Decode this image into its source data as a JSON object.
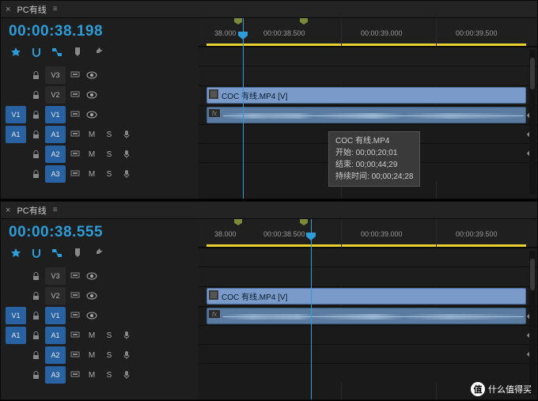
{
  "panels": [
    {
      "tab_close": "×",
      "tab_title": "PC有线",
      "menu_glyph": "≡",
      "timecode": "00:00:38.198",
      "ticks": [
        "38.000",
        "00:00:38.500",
        "00:00:39.000",
        "00:00:39.500"
      ],
      "tracks": {
        "v3": {
          "label": "V3"
        },
        "v2": {
          "label": "V2"
        },
        "v1": {
          "src": "V1",
          "tgt": "V1"
        },
        "a1": {
          "src": "A1",
          "tgt": "A1",
          "m": "M",
          "s": "S"
        },
        "a2": {
          "tgt": "A2",
          "m": "M",
          "s": "S"
        },
        "a3": {
          "tgt": "A3",
          "m": "M",
          "s": "S"
        }
      },
      "clip_label": "COC  有线.MP4 [V]",
      "tooltip": {
        "name": "COC  有线.MP4",
        "start_l": "开始: ",
        "start_v": "00;00;20;01",
        "end_l": "结束: ",
        "end_v": "00;00;44;29",
        "dur_l": "持续时间: ",
        "dur_v": "00;00;24;28"
      }
    },
    {
      "tab_close": "×",
      "tab_title": "PC有线",
      "menu_glyph": "≡",
      "timecode": "00:00:38.555",
      "ticks": [
        "38.000",
        "00:00:38.500",
        "00:00:39.000",
        "00:00:39.500"
      ],
      "tracks": {
        "v3": {
          "label": "V3"
        },
        "v2": {
          "label": "V2"
        },
        "v1": {
          "src": "V1",
          "tgt": "V1"
        },
        "a1": {
          "src": "A1",
          "tgt": "A1",
          "m": "M",
          "s": "S"
        },
        "a2": {
          "tgt": "A2",
          "m": "M",
          "s": "S"
        },
        "a3": {
          "tgt": "A3",
          "m": "M",
          "s": "S"
        }
      },
      "clip_label": "COC  有线.MP4 [V]"
    }
  ],
  "watermark": "什么值得买"
}
